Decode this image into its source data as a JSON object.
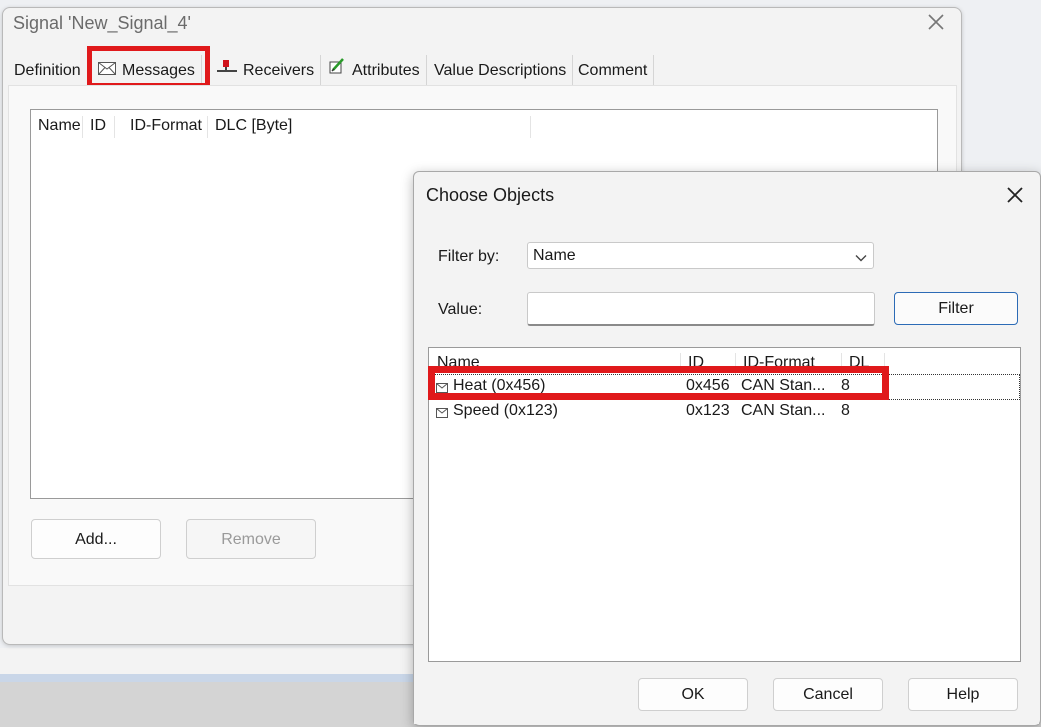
{
  "main_window": {
    "title": "Signal 'New_Signal_4'",
    "tabs": [
      {
        "label": "Definition",
        "icon": null
      },
      {
        "label": "Messages",
        "icon": "envelope-icon"
      },
      {
        "label": "Receivers",
        "icon": "receiver-icon"
      },
      {
        "label": "Attributes",
        "icon": "attributes-icon"
      },
      {
        "label": "Value Descriptions",
        "icon": null
      },
      {
        "label": "Comment",
        "icon": null
      }
    ],
    "active_tab": "Messages",
    "list_columns": [
      "Name",
      "ID",
      "ID-Format",
      "DLC [Byte]"
    ],
    "buttons": {
      "add": "Add...",
      "remove": "Remove"
    }
  },
  "dialog": {
    "title": "Choose Objects",
    "filter_by_label": "Filter by:",
    "filter_by_value": "Name",
    "value_label": "Value:",
    "value_input": "",
    "filter_button": "Filter",
    "columns": [
      "Name",
      "ID",
      "ID-Format",
      "DL"
    ],
    "rows": [
      {
        "name": "Heat (0x456)",
        "id": "0x456",
        "format": "CAN Stan...",
        "dl": "8",
        "selected": true
      },
      {
        "name": "Speed (0x123)",
        "id": "0x123",
        "format": "CAN Stan...",
        "dl": "8",
        "selected": false
      }
    ],
    "buttons": {
      "ok": "OK",
      "cancel": "Cancel",
      "help": "Help"
    }
  },
  "colors": {
    "highlight": "#e0191b",
    "accent_border": "#2c6bb6",
    "window_bg": "#f3f3f3"
  }
}
